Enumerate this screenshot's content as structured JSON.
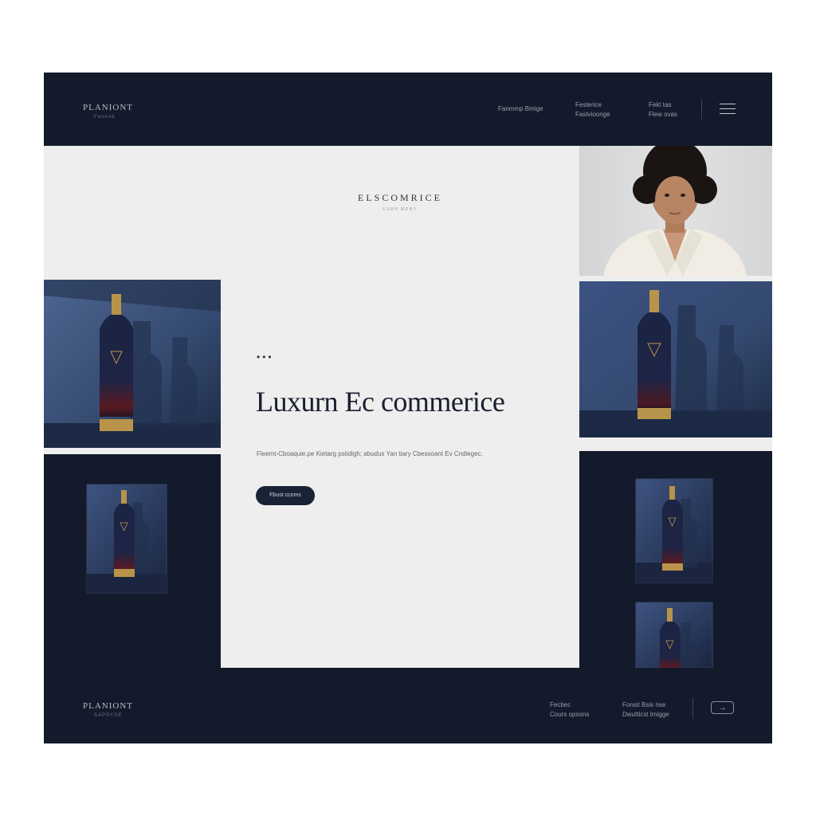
{
  "header": {
    "brand": "PLANIONT",
    "brand_sub": "Fanend",
    "nav": [
      {
        "line1": "Fanmmp Bmige",
        "line2": ""
      },
      {
        "line1": "Festerice",
        "line2": "Fastvioonge"
      },
      {
        "line1": "Fekt tas",
        "line2": "Flew ovas"
      }
    ],
    "menu_icon": "hamburger-menu-icon"
  },
  "hero": {
    "logo": "ELSCOMRICE",
    "logo_sub": "FURN MERY",
    "dots": "•••",
    "title": "Luxurn Ec commerice",
    "description": "Fleemt-Cboaquie.pe Kietarg pstidigh; abudus Yan tiary Cbessoant Ev Cndiegec.",
    "cta_label": "Fbust ccoms"
  },
  "footer": {
    "brand": "PLANIONT",
    "brand_sub": "SAPSYOE",
    "links": [
      {
        "line1": "Fecbec",
        "line2": "Cours opsons"
      },
      {
        "line1": "Fonsit Bsis nse",
        "line2": "Dwutticst Imigge"
      }
    ],
    "arrow": "→",
    "arrow_icon": "arrow-right-icon"
  },
  "colors": {
    "navy": "#121a2b",
    "blue_panel": "#33496f",
    "gold": "#b8944a",
    "background": "#eeeeee"
  }
}
